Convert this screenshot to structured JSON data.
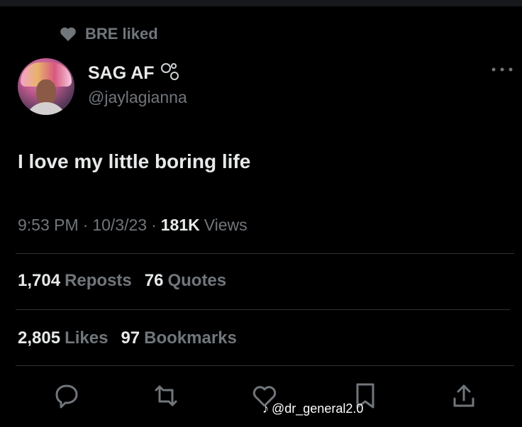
{
  "social_context": {
    "text": "BRE liked",
    "icon": "heart-icon"
  },
  "author": {
    "display_name": "SAG AF",
    "handle": "@jaylagianna",
    "emoji": "bubbles-icon"
  },
  "tweet": {
    "text": "I love my little boring life"
  },
  "meta": {
    "time": "9:53 PM",
    "sep1": "·",
    "date": "10/3/23",
    "sep2": "·",
    "views_count": "181K",
    "views_label": "Views"
  },
  "stats": {
    "reposts_count": "1,704",
    "reposts_label": "Reposts",
    "quotes_count": "76",
    "quotes_label": "Quotes",
    "likes_count": "2,805",
    "likes_label": "Likes",
    "bookmarks_count": "97",
    "bookmarks_label": "Bookmarks"
  },
  "actions": [
    "reply-icon",
    "repost-icon",
    "like-icon",
    "bookmark-icon",
    "share-icon"
  ],
  "watermark": {
    "text": "@dr_general2.0"
  },
  "colors": {
    "background": "#000000",
    "text": "#e7e9ea",
    "muted": "#71767b",
    "divider": "#2f3336"
  }
}
